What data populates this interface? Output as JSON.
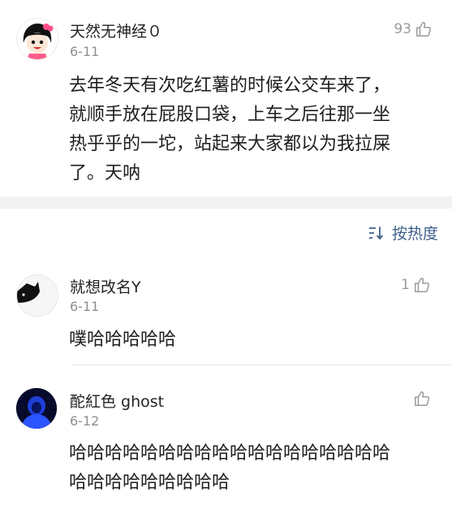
{
  "main_post": {
    "username": "天然无神经０",
    "date": "6-11",
    "likes": "93",
    "lines": [
      "去年冬天有次吃红薯的时候公交车来了，",
      "就顺手放在屁股口袋，上车之后往那一坐",
      "热乎乎的一坨，站起来大家都以为我拉屎",
      "了。天呐"
    ]
  },
  "sort": {
    "label": "按热度",
    "icon": "sort-icon"
  },
  "replies": [
    {
      "username": "就想改名Y",
      "date": "6-11",
      "likes": "1",
      "lines": [
        "噗哈哈哈哈哈"
      ]
    },
    {
      "username": "酡紅色 ghost",
      "date": "6-12",
      "likes": "",
      "lines": [
        "哈哈哈哈哈哈哈哈哈哈哈哈哈哈哈哈哈哈",
        "哈哈哈哈哈哈哈哈哈"
      ]
    }
  ],
  "colors": {
    "sort_accent": "#3e5f8a",
    "meta_gray": "#8f8f8f",
    "band_gray": "#f2f2f2"
  }
}
